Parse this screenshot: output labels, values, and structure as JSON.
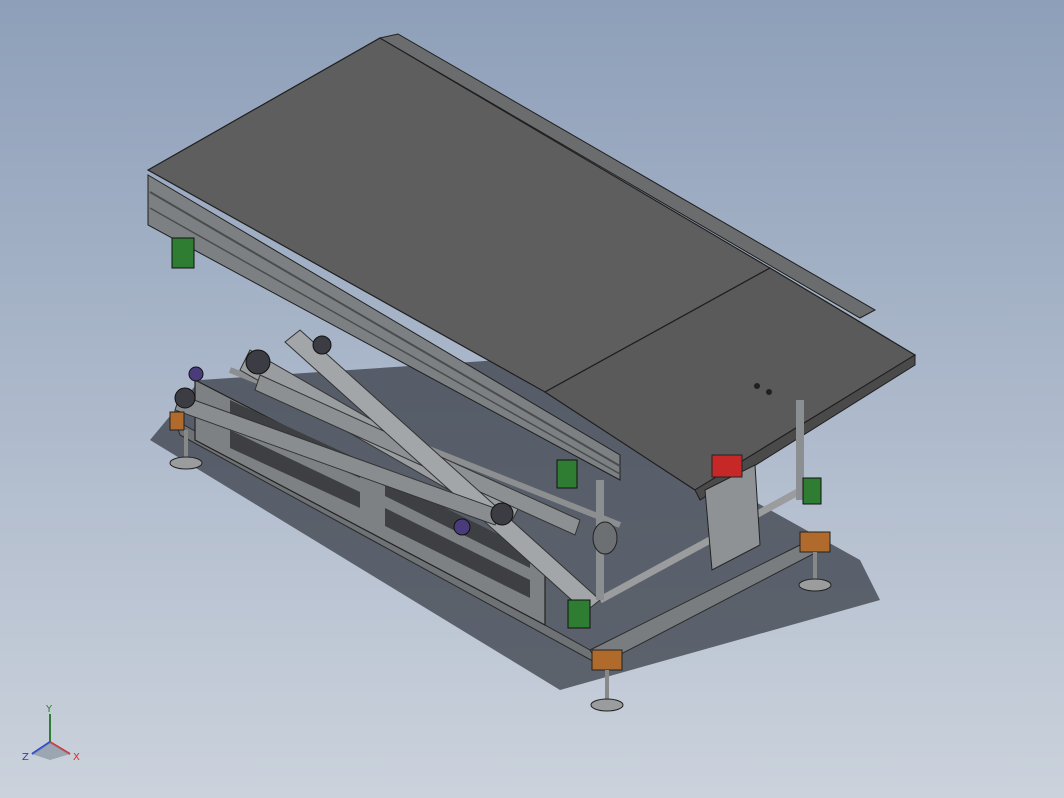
{
  "viewport": {
    "background_top": "#8e9fb9",
    "background_bottom": "#cbd2dc"
  },
  "model": {
    "parts": [
      "tabletop-panel",
      "tabletop-extension-panel",
      "aluminium-extrusion-rail",
      "scissor-arms",
      "side-frame-plate",
      "base-frame",
      "leveling-feet",
      "pillow-block-bearing",
      "actuator-cylinder",
      "mounting-brackets",
      "corner-blocks",
      "roller-wheels"
    ],
    "colors": {
      "panel": "#5e5e5e",
      "rail": "#8a8c8e",
      "frame": "#6f7275",
      "bracket": "#2e7d32",
      "corner_block": "#b06a2b",
      "actuator_accent": "#c62828",
      "roller": "#3c3c44",
      "shadow": "#3a3f48"
    }
  },
  "triad": {
    "x_label": "X",
    "y_label": "Y",
    "z_label": "Z",
    "x_color": "#d32f2f",
    "y_color": "#2e7d32",
    "z_color": "#1e3fd0"
  }
}
